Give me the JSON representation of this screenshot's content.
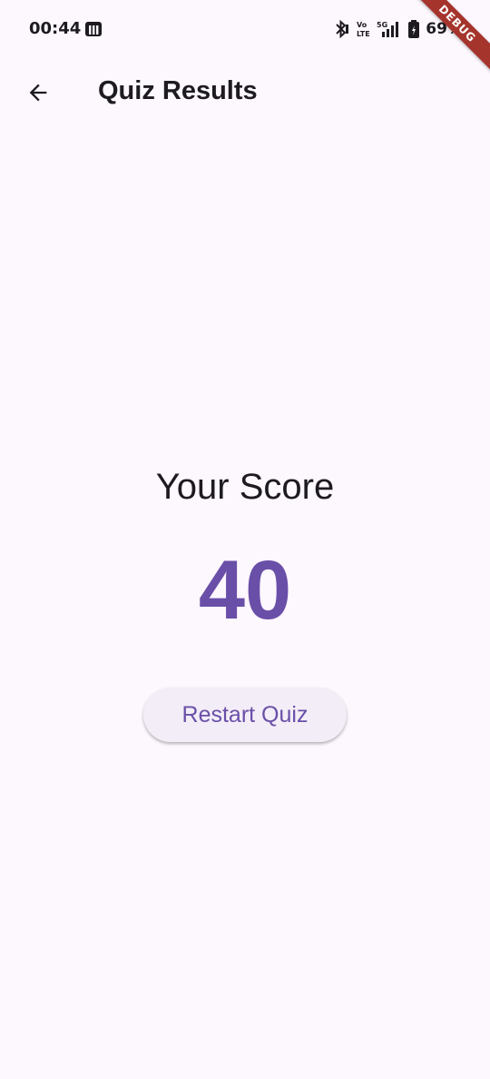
{
  "status_bar": {
    "time": "00:44",
    "battery": "69%",
    "icons": [
      "app-m-icon",
      "bluetooth-icon",
      "volte-icon",
      "5g-signal-icon",
      "battery-icon"
    ]
  },
  "debug_banner": "DEBUG",
  "app_bar": {
    "back_icon": "arrow-back-icon",
    "title": "Quiz Results"
  },
  "results": {
    "label": "Your Score",
    "score": "40"
  },
  "actions": {
    "restart_label": "Restart Quiz"
  },
  "colors": {
    "background": "#fdf7fe",
    "accent": "#6a4fa8",
    "button_bg": "#f3edf7",
    "debug_ribbon": "#a5342c"
  }
}
